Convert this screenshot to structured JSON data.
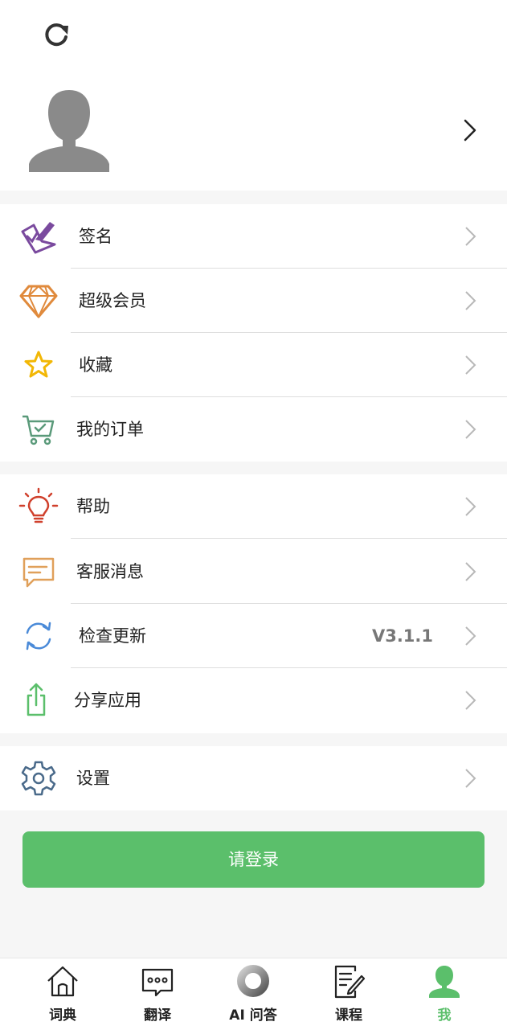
{
  "menu_group1": [
    {
      "label": "签名",
      "icon": "signature-icon"
    },
    {
      "label": "超级会员",
      "icon": "diamond-icon"
    },
    {
      "label": "收藏",
      "icon": "star-icon"
    },
    {
      "label": "我的订单",
      "icon": "cart-icon"
    }
  ],
  "menu_group2": [
    {
      "label": "帮助",
      "icon": "lightbulb-icon"
    },
    {
      "label": "客服消息",
      "icon": "chat-message-icon"
    },
    {
      "label": "检查更新",
      "icon": "sync-icon",
      "value": "V3.1.1"
    },
    {
      "label": "分享应用",
      "icon": "share-icon"
    }
  ],
  "menu_group3": [
    {
      "label": "设置",
      "icon": "gear-icon"
    }
  ],
  "login_button": "请登录",
  "tabs": [
    {
      "label": "词典",
      "icon": "home-icon"
    },
    {
      "label": "翻译",
      "icon": "translate-bubble-icon"
    },
    {
      "label": "AI 问答",
      "icon": "ai-ring-icon"
    },
    {
      "label": "课程",
      "icon": "notebook-pen-icon"
    },
    {
      "label": "我",
      "icon": "person-icon",
      "active": true
    }
  ],
  "colors": {
    "accent": "#5bbf6b",
    "signature": "#7a4a9e",
    "diamond": "#e08a3c",
    "star": "#f2b705",
    "cart": "#5a9a7a",
    "bulb": "#d0402c",
    "chat": "#e0a05a",
    "sync": "#4a8ad8",
    "share": "#5bbf6b",
    "gear": "#4a6a8a"
  }
}
